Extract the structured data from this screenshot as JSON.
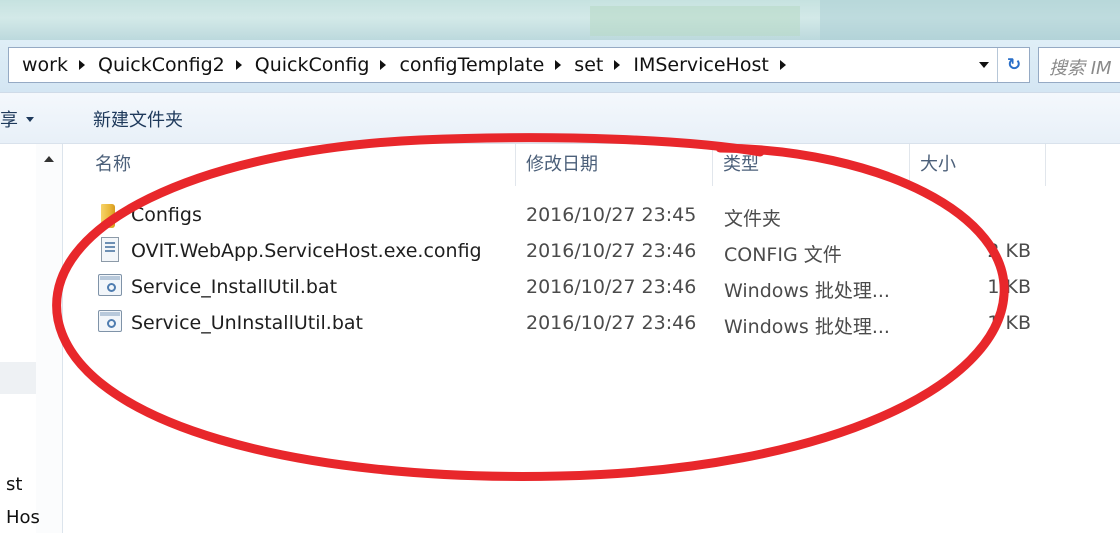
{
  "breadcrumb": [
    "work",
    "QuickConfig2",
    "QuickConfig",
    "configTemplate",
    "set",
    "IMServiceHost"
  ],
  "search": {
    "placeholder": "搜索 IM"
  },
  "toolbar": {
    "share_label": "享",
    "new_folder_label": "新建文件夹"
  },
  "columns": {
    "name": "名称",
    "date": "修改日期",
    "type": "类型",
    "size": "大小"
  },
  "files": [
    {
      "name": "Configs",
      "date": "2016/10/27 23:45",
      "type": "文件夹",
      "size": "",
      "icon": "folder-icon"
    },
    {
      "name": "OVIT.WebApp.ServiceHost.exe.config",
      "date": "2016/10/27 23:46",
      "type": "CONFIG 文件",
      "size": "2 KB",
      "icon": "config-file-icon"
    },
    {
      "name": "Service_InstallUtil.bat",
      "date": "2016/10/27 23:46",
      "type": "Windows 批处理...",
      "size": "1 KB",
      "icon": "batch-file-icon"
    },
    {
      "name": "Service_UnInstallUtil.bat",
      "date": "2016/10/27 23:46",
      "type": "Windows 批处理...",
      "size": "1 KB",
      "icon": "batch-file-icon"
    }
  ],
  "nav_pane": {
    "items": [
      "st",
      "Hos"
    ]
  },
  "colors": {
    "annotation": "#e8272b",
    "header_text": "#4c607a",
    "address_border": "#95aac4"
  }
}
